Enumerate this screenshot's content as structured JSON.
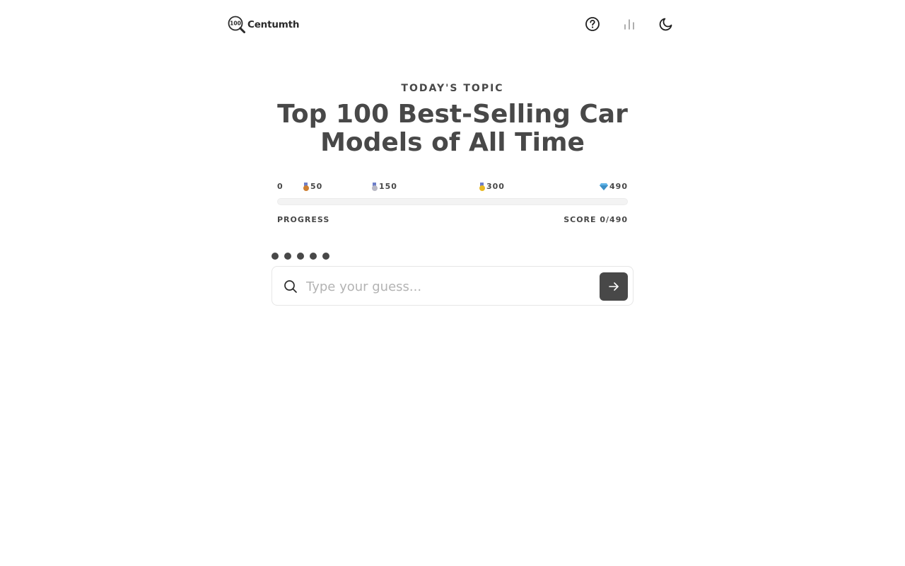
{
  "app": {
    "name": "Centumth",
    "logo_mark_text": "100"
  },
  "header": {
    "icons": [
      "help-circle-icon",
      "bar-chart-icon",
      "moon-icon"
    ]
  },
  "topic": {
    "label": "TODAY'S TOPIC",
    "title": "Top 100 Best-Selling Car Models of All Time"
  },
  "progress": {
    "milestones": [
      {
        "label": "0",
        "icon": "none"
      },
      {
        "label": "50",
        "icon": "bronze-medal-icon"
      },
      {
        "label": "150",
        "icon": "silver-medal-icon"
      },
      {
        "label": "300",
        "icon": "gold-medal-icon"
      },
      {
        "label": "490",
        "icon": "diamond-icon"
      }
    ],
    "fill_fraction": 0,
    "label": "PROGRESS",
    "score_text": "SCORE 0/490"
  },
  "lives": {
    "count": 5
  },
  "guess": {
    "placeholder": "Type your guess...",
    "value": ""
  },
  "colors": {
    "text": "#484848",
    "bronze": "#cd7f32",
    "silver": "#b8b8c4",
    "gold": "#e8b923",
    "diamond": "#5fb3e6",
    "placeholder": "#b3b3b3",
    "track": "#f3f3f3"
  }
}
